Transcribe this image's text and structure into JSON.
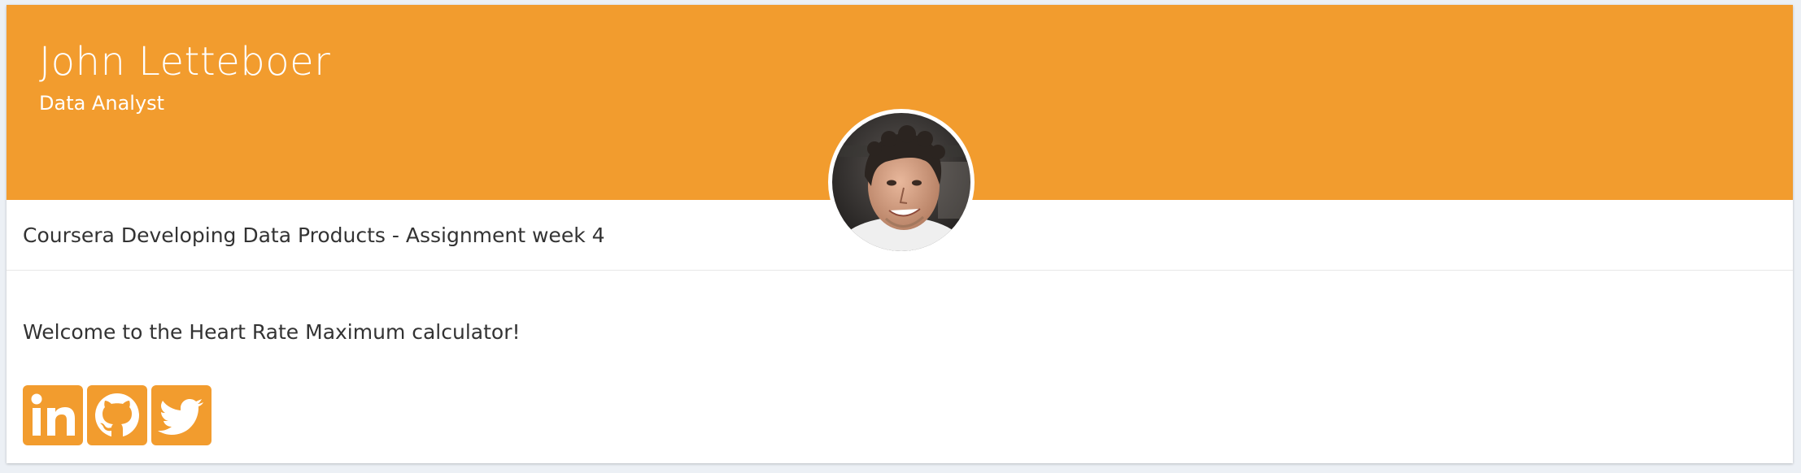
{
  "profile": {
    "name": "John Letteboer",
    "role": "Data Analyst",
    "subtitle": "Coursera Developing Data Products - Assignment week 4",
    "avatar_alt": "profile photo"
  },
  "body": {
    "welcome": "Welcome to the Heart Rate Maximum calculator!"
  },
  "social_links": [
    {
      "icon": "linkedin-icon"
    },
    {
      "icon": "github-icon"
    },
    {
      "icon": "twitter-icon"
    }
  ],
  "colors": {
    "accent": "#f29c2e",
    "background": "#ecf0f5",
    "card": "#ffffff",
    "text": "#333333"
  }
}
